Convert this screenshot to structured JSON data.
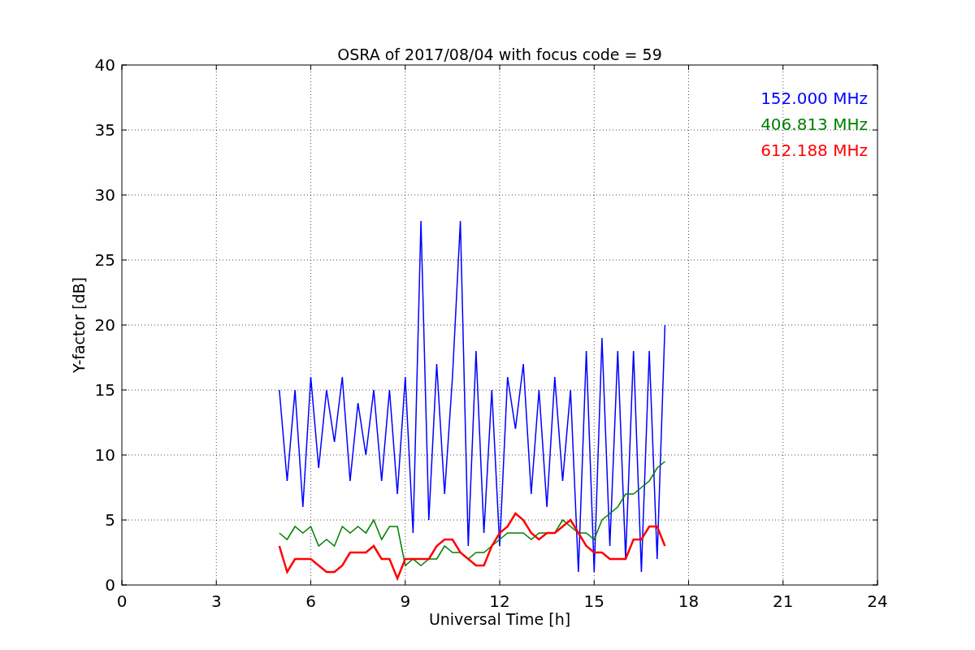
{
  "chart_data": {
    "type": "line",
    "title": "OSRA of 2017/08/04 with focus code = 59",
    "xlabel": "Universal Time [h]",
    "ylabel": "Y-factor [dB]",
    "x": [
      5,
      5.25,
      5.5,
      5.75,
      6,
      6.25,
      6.5,
      6.75,
      7,
      7.25,
      7.5,
      7.75,
      8,
      8.25,
      8.5,
      8.75,
      9,
      9.25,
      9.5,
      9.75,
      10,
      10.25,
      10.5,
      10.75,
      11,
      11.25,
      11.5,
      11.75,
      12,
      12.25,
      12.5,
      12.75,
      13,
      13.25,
      13.5,
      13.75,
      14,
      14.25,
      14.5,
      14.75,
      15,
      15.25,
      15.5,
      15.75,
      16,
      16.25,
      16.5,
      16.75,
      17,
      17.25
    ],
    "series": [
      {
        "name": "152.000 MHz",
        "color": "#0000ff",
        "values": [
          15,
          8,
          15,
          6,
          16,
          9,
          15,
          11,
          16,
          8,
          14,
          10,
          15,
          8,
          15,
          7,
          16,
          4,
          28,
          5,
          17,
          7,
          16,
          28,
          3,
          18,
          4,
          15,
          3,
          16,
          12,
          17,
          7,
          15,
          6,
          16,
          8,
          15,
          1,
          18,
          1,
          19,
          3,
          18,
          2,
          18,
          1,
          18,
          2,
          20
        ]
      },
      {
        "name": "406.813 MHz",
        "color": "#008000",
        "values": [
          4,
          3.5,
          4.5,
          4,
          4.5,
          3,
          3.5,
          3,
          4.5,
          4,
          4.5,
          4,
          5,
          3.5,
          4.5,
          4.5,
          1.5,
          2,
          1.5,
          2,
          2,
          3,
          2.5,
          2.5,
          2,
          2.5,
          2.5,
          3,
          3.5,
          4,
          4,
          4,
          3.5,
          4,
          4,
          4,
          5,
          4.5,
          4,
          4,
          3.5,
          5,
          5.5,
          6,
          7,
          7,
          7.5,
          8,
          9,
          9.5
        ]
      },
      {
        "name": "612.188 MHz",
        "color": "#ff0000",
        "values": [
          3,
          1,
          2,
          2,
          2,
          1.5,
          1,
          1,
          1.5,
          2.5,
          2.5,
          2.5,
          3,
          2,
          2,
          0.5,
          2,
          2,
          2,
          2,
          3,
          3.5,
          3.5,
          2.5,
          2,
          1.5,
          1.5,
          3,
          4,
          4.5,
          5.5,
          5,
          4,
          3.5,
          4,
          4,
          4.5,
          5,
          4,
          3,
          2.5,
          2.5,
          2,
          2,
          2,
          3.5,
          3.5,
          4.5,
          4.5,
          3
        ]
      }
    ],
    "xlim": [
      0,
      24
    ],
    "ylim": [
      0,
      40
    ],
    "xticks": [
      0,
      3,
      6,
      9,
      12,
      15,
      18,
      21,
      24
    ],
    "yticks": [
      0,
      5,
      10,
      15,
      20,
      25,
      30,
      35,
      40
    ],
    "grid": true
  }
}
